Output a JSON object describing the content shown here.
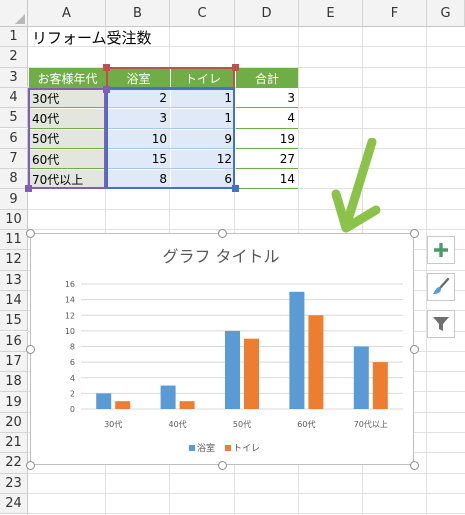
{
  "sheet": {
    "columns": [
      "A",
      "B",
      "C",
      "D",
      "E",
      "F",
      "G"
    ],
    "rows": [
      "1",
      "2",
      "3",
      "4",
      "5",
      "6",
      "7",
      "8",
      "9",
      "10",
      "11",
      "12",
      "13",
      "14",
      "15",
      "16",
      "17",
      "18",
      "19",
      "20",
      "21",
      "22",
      "23",
      "24"
    ],
    "title": "リフォーム受注数",
    "table_header": {
      "age": "お客様年代",
      "bath": "浴室",
      "toilet": "トイレ",
      "total": "合計"
    },
    "table_rows": [
      {
        "age": "30代",
        "bath": "2",
        "toilet": "1",
        "total": "3"
      },
      {
        "age": "40代",
        "bath": "3",
        "toilet": "1",
        "total": "4"
      },
      {
        "age": "50代",
        "bath": "10",
        "toilet": "9",
        "total": "19"
      },
      {
        "age": "60代",
        "bath": "15",
        "toilet": "12",
        "total": "27"
      },
      {
        "age": "70代以上",
        "bath": "8",
        "toilet": "6",
        "total": "14"
      }
    ]
  },
  "colors": {
    "bath": "#5b9bd5",
    "toilet": "#ed7d31",
    "header_green": "#70ad47",
    "arrow_green": "#8bc34a"
  },
  "side_buttons": [
    {
      "icon": "plus-icon"
    },
    {
      "icon": "brush-icon"
    },
    {
      "icon": "filter-icon"
    }
  ],
  "chart_data": {
    "type": "bar",
    "title": "グラフ タイトル",
    "categories": [
      "30代",
      "40代",
      "50代",
      "60代",
      "70代以上"
    ],
    "series": [
      {
        "name": "浴室",
        "values": [
          2,
          3,
          10,
          15,
          8
        ],
        "color": "#5b9bd5"
      },
      {
        "name": "トイレ",
        "values": [
          1,
          1,
          9,
          12,
          6
        ],
        "color": "#ed7d31"
      }
    ],
    "ylim": [
      0,
      16
    ],
    "yticks": [
      "0",
      "2",
      "4",
      "6",
      "8",
      "10",
      "12",
      "14",
      "16"
    ],
    "grid": true,
    "legend": "bottom"
  }
}
